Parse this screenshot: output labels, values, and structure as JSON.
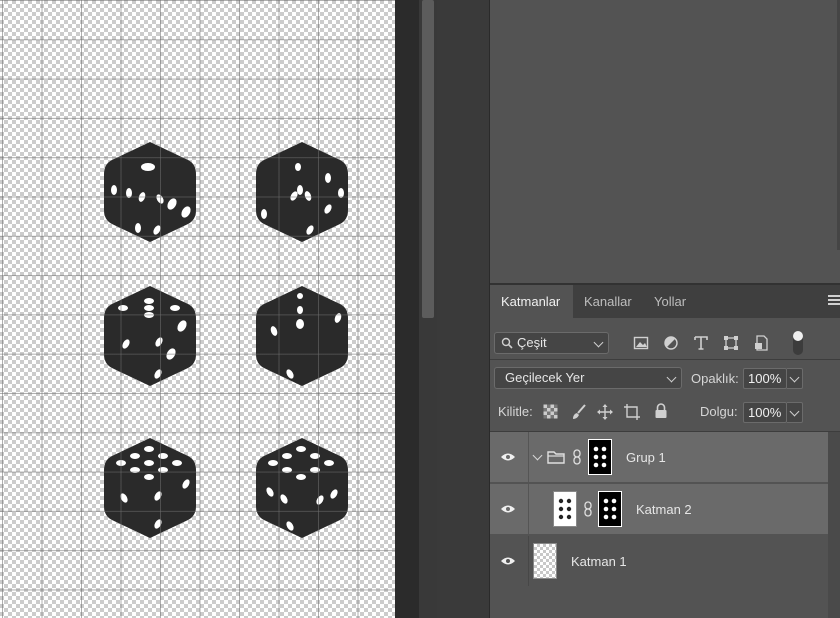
{
  "layers_panel": {
    "tabs": [
      {
        "label": "Katmanlar",
        "active": true
      },
      {
        "label": "Kanallar",
        "active": false
      },
      {
        "label": "Yollar",
        "active": false
      }
    ],
    "filter": {
      "kind_label": "Çeşit",
      "icon_names": [
        "image-filter-icon",
        "adjustment-filter-icon",
        "type-filter-icon",
        "shape-filter-icon",
        "smart-object-filter-icon",
        "filter-toggle-icon"
      ]
    },
    "blend_mode": "Geçilecek Yer",
    "opacity_label": "Opaklık:",
    "opacity_value": "100%",
    "lock_label": "Kilitle:",
    "lock_icon_names": [
      "lock-transparency-icon",
      "lock-image-icon",
      "lock-position-icon",
      "lock-artboard-icon",
      "lock-all-icon"
    ],
    "fill_label": "Dolgu:",
    "fill_value": "100%",
    "layers": [
      {
        "name": "Grup 1",
        "type": "group",
        "visible": true,
        "selected": true,
        "expanded": true
      },
      {
        "name": "Katman 2",
        "type": "layer",
        "visible": true,
        "selected": true,
        "masked": true
      },
      {
        "name": "Katman 1",
        "type": "layer",
        "visible": true,
        "selected": false
      }
    ]
  },
  "colors": {
    "panel_bg": "#535353",
    "selected_row": "#6a6a6a",
    "tab_bar": "#3f3f3f",
    "die_fill": "#2a2a2a",
    "pip": "#ffffff"
  }
}
